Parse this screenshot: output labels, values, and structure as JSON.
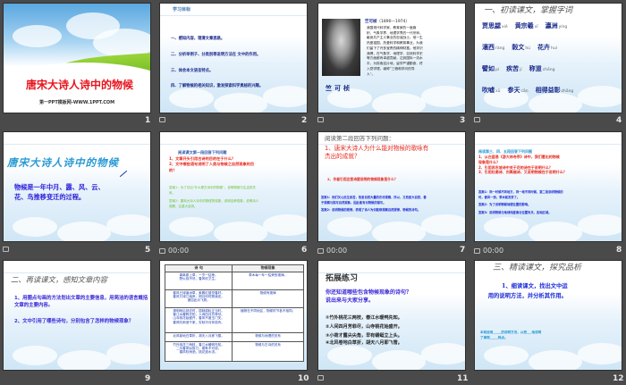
{
  "slides": [
    {
      "number": "1",
      "title": "唐宋大诗人诗中的物候",
      "subtitle": "第一PPT模板网-WWW.1PPT.COM"
    },
    {
      "number": "2",
      "heading": "学习目标",
      "items": [
        "一、感知内容，理清文章思路。",
        "二、分析举例子、分类别等说明方法在  文中的作用。",
        "三、体会本文语言特点。",
        "四、了解物候的相关知识，激发探索科学奥秘的兴趣。"
      ]
    },
    {
      "number": "3",
      "name_title": "竺可桢",
      "years": "（1890—1974）",
      "bio": [
        "我国现代科学家、教育家的一面旗",
        "帜、气象学界、地理学界的一代宗师，",
        "献身共产主义事业的忠诚战士。他一生",
        "热爱祖国，热爱科学和教育事业，为我",
        "们留下了许多宝贵的精神财富。他学识",
        "渊博，在气象学、地理学、自然科学史",
        "等方面都有卓越贡献，达到国际一流水",
        "平。为探索这片地，留学严谨勤奋，终",
        "入党学理，堪称“三栖和学问的导",
        "人”。"
      ],
      "signature": "竺可桢"
    },
    {
      "number": "4",
      "heading": "一、初读课文，掌握字词",
      "words": [
        [
          {
            "w": "贾思勰",
            "p": "xié"
          },
          {
            "w": "黄宗羲",
            "p": "xī"
          },
          {
            "w": "瀛洲",
            "p": "yíng"
          }
        ],
        [
          {
            "w": "瀼西",
            "p": "ràng"
          },
          {
            "w": "榖文",
            "p": "hú"
          },
          {
            "w": "花卉",
            "p": "huì"
          }
        ],
        [
          {
            "w": "譬如",
            "p": "pì"
          },
          {
            "w": "疾苦",
            "p": "jí"
          },
          {
            "w": "称道",
            "p": "chēng"
          }
        ],
        [
          {
            "w": "吹嘘",
            "p": "xū"
          },
          {
            "w": "参天",
            "p": "cān"
          },
          {
            "w": "相得益彰",
            "p": "zhāng"
          }
        ]
      ]
    },
    {
      "number": "5",
      "title": "唐宋大诗人诗中的物候",
      "definition": [
        "物候是一年中月、露、风、云、",
        "花、鸟推移变迁的过程。"
      ]
    },
    {
      "number": "6",
      "time": "00:00",
      "heading": "阅读课文第一段回答下列问题",
      "questions": [
        "1、文章开头引用古诗的目的在于什么？",
        "2、文中哪些语句说明了人类与物候之自然现象的目",
        "的？"
      ],
      "answers": [
        "答案1：为了引出“什么是古诗中的物候”，说明物候与生活的关",
        "系。",
        "答案2：唐宋大诗人诗中的物候的现象，说明这种现象，说明诗人",
        "观察，注重大自然。"
      ]
    },
    {
      "number": "7",
      "time": "00:00",
      "heading": "阅读第二段回答下列问题：",
      "question1": [
        "1、唐宋大诗人为什么能对物候的歌咏有",
        "杰出的成就？"
      ],
      "question2": "2、作者引用这首诗要说明的物候现象是什么？",
      "answers": [
        "答案1：他们关心民生疾苦，热爱自然大量的农村观察，所以，又热爱大自然，善",
        "于观察与描写自然现象，因此能有对物候的描写。",
        "答案2：说明物候的规律，表现了诗人为何能够观察自然规律，物候的诗句。"
      ]
    },
    {
      "number": "8",
      "time": "00:00",
      "heading": "阅读第三、四、五段回答下列问题",
      "questions": [
        "1、从白居易《游大林寺序》诗中，我们看出的物候",
        "现象是什么？",
        "2、引用苏东坡诗中关于花的诗在于说明什么？",
        "3、引用杜甫诗、刘禹锡诗，又说明物候在于说明什么？"
      ],
      "answers": [
        "答案1：同一时候不同地方，同一地不同时候，第二段说明物候的",
        "时，春风一到，草木就发芽了。",
        "答案2：为了说明物候地理位置的影响。",
        "答案3：说明物候与地球纬度南北位置有关，各地区域。"
      ]
    },
    {
      "number": "9",
      "heading": "二、再读课文，感知文章内容",
      "items": [
        "1、用圈点勾画的方法划出文章的主要信息，用简洁的语言概括文章的主要内容。",
        "2、文中引用了哪些诗句，分别包含了怎样的物候现象？"
      ]
    },
    {
      "number": "10",
      "table": {
        "headers": [
          "诗  句",
          "物候现象"
        ],
        "rows": [
          [
            [
              "离离原上草，一岁一枯荣。",
              "野火烧不尽，春风吹又生。"
            ],
            [
              "草木每一年一枯荣的规律。"
            ]
          ],
          [
            [
              "春风已绿瀛洲草，紫殿红楼觉春好。",
              "春风又绿江南岸，明月何时照我还。",
              "诸如此月飞燕。"
            ],
            [
              "物候有规律"
            ]
          ],
          [
            [
              "清明雨后到农时，插秧耕耘正当时。",
              "春江水暖鸭先知，人间四月芳菲尽。",
              "山寺桃花始盛开，春风不度玉门关。",
              "春风吹雨洒千家，穷秋冷月伴孤舟。"
            ],
            [
              "植物在不同地区，物候时节各不相同。"
            ]
          ],
          [
            [
              "北风卷地白草折，胡天八月即飞雪。"
            ],
            [
              "物候与地理的关系"
            ]
          ],
          [
            [
              "竹外桃花三两枝，春江水暖鸭先知。",
              "二月春风似剪刀，柳条不可说。",
              "春风吹雨洒，桃花逐水流。"
            ],
            [
              "物候与古诗的关系"
            ]
          ]
        ]
      }
    },
    {
      "number": "11",
      "heading": "拓展练习",
      "prompt": [
        "你还知道哪些包含物候现象的诗句？",
        "说出来与大家分享。"
      ],
      "poems": [
        "①竹外桃花三两枝，春江水暖鸭先知。",
        "②人间四月芳菲尽，山寺桃花始盛开。",
        "③小荷才露尖尖角，早有蜻蜓立上头。",
        "④北风卷地白草折，胡天八月即飞雪。"
      ]
    },
    {
      "number": "12",
      "heading": "三、精读课文，探究品析",
      "question": [
        "1、细读课文，找出文中运",
        "用的说明方法，并分析其作用。"
      ],
      "fill": [
        "本段运用_____的说明方法，从而___地说明",
        "了事物_____特点。"
      ]
    }
  ]
}
